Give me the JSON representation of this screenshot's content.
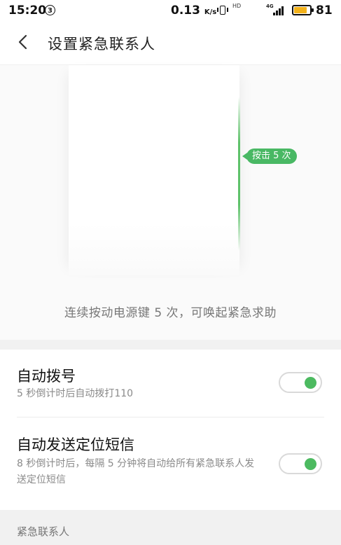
{
  "status_bar": {
    "time": "15:20",
    "circle_badge": "3",
    "speed": "0.13",
    "speed_unit": "K/s",
    "hd_label": "HD",
    "network_label": "4G",
    "battery_text": "81",
    "battery_level": 0.81,
    "battery_color": "#f3b21a"
  },
  "header": {
    "back_icon": "chevron-left-icon",
    "title": "设置紧急联系人"
  },
  "illustration": {
    "press_badge": "按击 5 次",
    "caption": "连续按动电源键 5 次，可唤起紧急求助",
    "accent_color": "#49b864"
  },
  "settings": [
    {
      "title": "自动拨号",
      "desc": "5 秒倒计时后自动拨打110",
      "enabled": true
    },
    {
      "title": "自动发送定位短信",
      "desc": "8 秒倒计时后，每隔 5 分钟将自动给所有紧急联系人发送定位短信",
      "enabled": true
    }
  ],
  "contacts_section": {
    "header": "紧急联系人"
  }
}
